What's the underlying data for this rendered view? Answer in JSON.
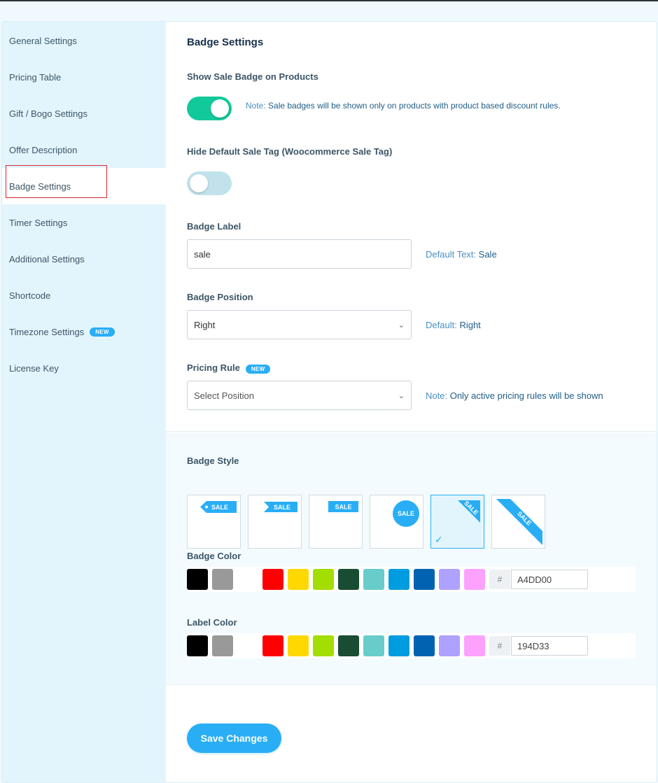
{
  "sidebar": {
    "items": [
      {
        "label": "General Settings"
      },
      {
        "label": "Pricing Table"
      },
      {
        "label": "Gift / Bogo Settings"
      },
      {
        "label": "Offer Description"
      },
      {
        "label": "Badge Settings",
        "active": true
      },
      {
        "label": "Timer Settings"
      },
      {
        "label": "Additional Settings"
      },
      {
        "label": "Shortcode"
      },
      {
        "label": "Timezone Settings",
        "badge": "NEW"
      },
      {
        "label": "License Key"
      }
    ]
  },
  "main": {
    "title": "Badge Settings",
    "show_sale_badge": {
      "label": "Show Sale Badge on Products",
      "enabled": true,
      "note_key": "Note:",
      "note_text": "Sale badges will be shown only on products with product based discount rules."
    },
    "hide_default_sale_tag": {
      "label": "Hide Default Sale Tag (Woocommerce Sale Tag)",
      "enabled": false
    },
    "badge_label": {
      "label": "Badge Label",
      "value": "sale",
      "helper_key": "Default Text:",
      "helper_value": "Sale"
    },
    "badge_position": {
      "label": "Badge Position",
      "value": "Right",
      "helper_key": "Default:",
      "helper_value": "Right"
    },
    "pricing_rule": {
      "label": "Pricing Rule",
      "badge": "NEW",
      "placeholder": "Select Position",
      "helper_key": "Note:",
      "helper_value": "Only active pricing rules will be shown"
    },
    "badge_style": {
      "label": "Badge Style",
      "badge_text": "SALE",
      "selected_index": 4
    },
    "badge_color": {
      "label": "Badge Color",
      "hash": "#",
      "value": "A4DD00"
    },
    "label_color": {
      "label": "Label Color",
      "hash": "#",
      "value": "194D33"
    },
    "palette": [
      "#000000",
      "#999999",
      "#ffffff",
      "#ff0000",
      "#ffd800",
      "#a4dd00",
      "#194d33",
      "#68ccca",
      "#009ce0",
      "#0062b1",
      "#aea1ff",
      "#fda1ff"
    ],
    "save_label": "Save Changes"
  },
  "colors": {
    "accent": "#29aef5",
    "toggle_on": "#12c99b",
    "toggle_off": "#c1e2ea",
    "sidebar_bg": "#e2f5fd",
    "highlight": "#d9252c"
  }
}
